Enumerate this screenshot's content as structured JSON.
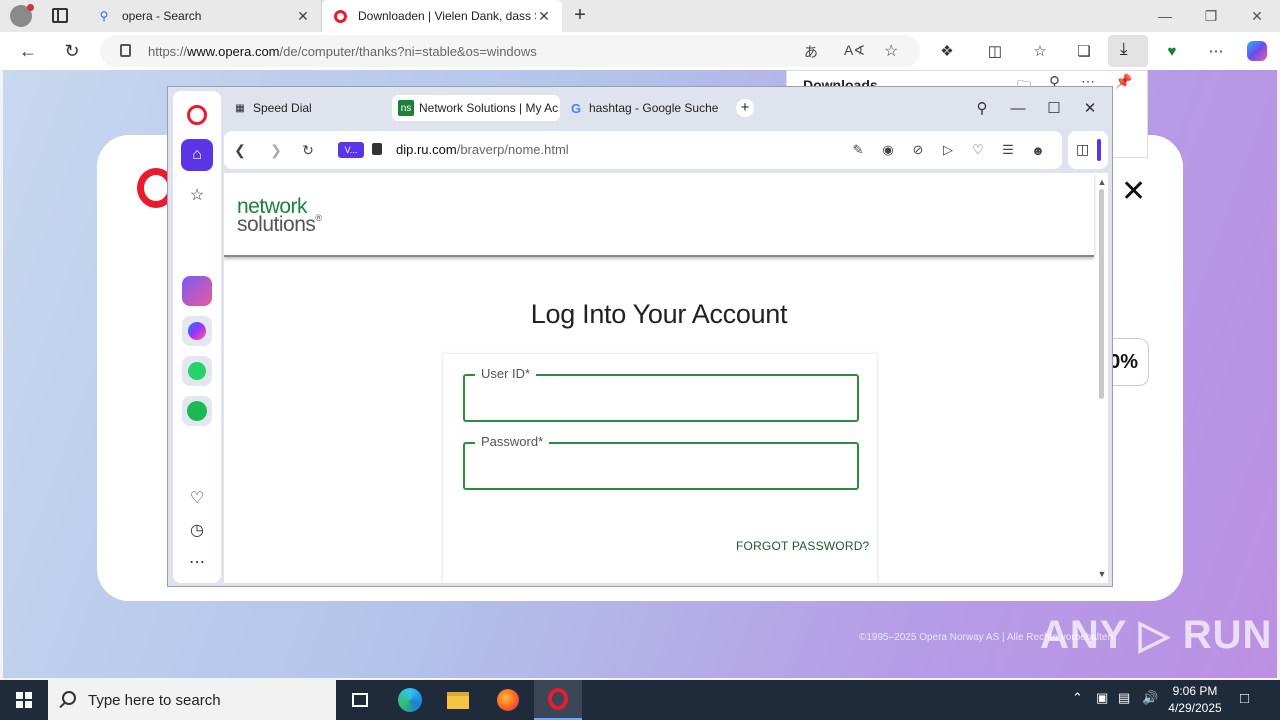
{
  "edge": {
    "tabs": [
      {
        "title": "opera - Search",
        "icon": "search-icon"
      },
      {
        "title": "Downloaden | Vielen Dank, dass Sie",
        "icon": "opera-icon"
      }
    ],
    "url_prefix": "https://",
    "url_host": "www.opera.com",
    "url_path": "/de/computer/thanks?ni=stable&os=windows",
    "downloads_title": "Downloads"
  },
  "opera_page": {
    "pill_text": "0%",
    "footer": "©1995–2025 Opera Norway AS | Alle Rechte vorbehalten"
  },
  "opera_browser": {
    "tabs": [
      {
        "title": "Speed Dial",
        "icon": "speed-dial-icon"
      },
      {
        "title": "Network Solutions | My Ac",
        "icon": "ns-favicon",
        "badge": "ns"
      },
      {
        "title": "hashtag - Google Suche",
        "icon": "google-icon"
      }
    ],
    "vpn_label": "V...",
    "url_host": "dip.ru.com",
    "url_path": "/braverp/nome.html"
  },
  "login": {
    "logo_line1": "network",
    "logo_line2": "solutions",
    "logo_mark": "®",
    "title": "Log Into Your Account",
    "user_label": "User ID*",
    "password_label": "Password*",
    "forgot": "FORGOT PASSWORD?"
  },
  "watermark": "ANY ▷ RUN",
  "taskbar": {
    "search_placeholder": "Type here to search",
    "time": "9:06 PM",
    "date": "4/29/2025"
  },
  "colors": {
    "opera_red": "#e81c2c",
    "opera_purple": "#5a35e8",
    "ns_green": "#2e8b3f"
  }
}
